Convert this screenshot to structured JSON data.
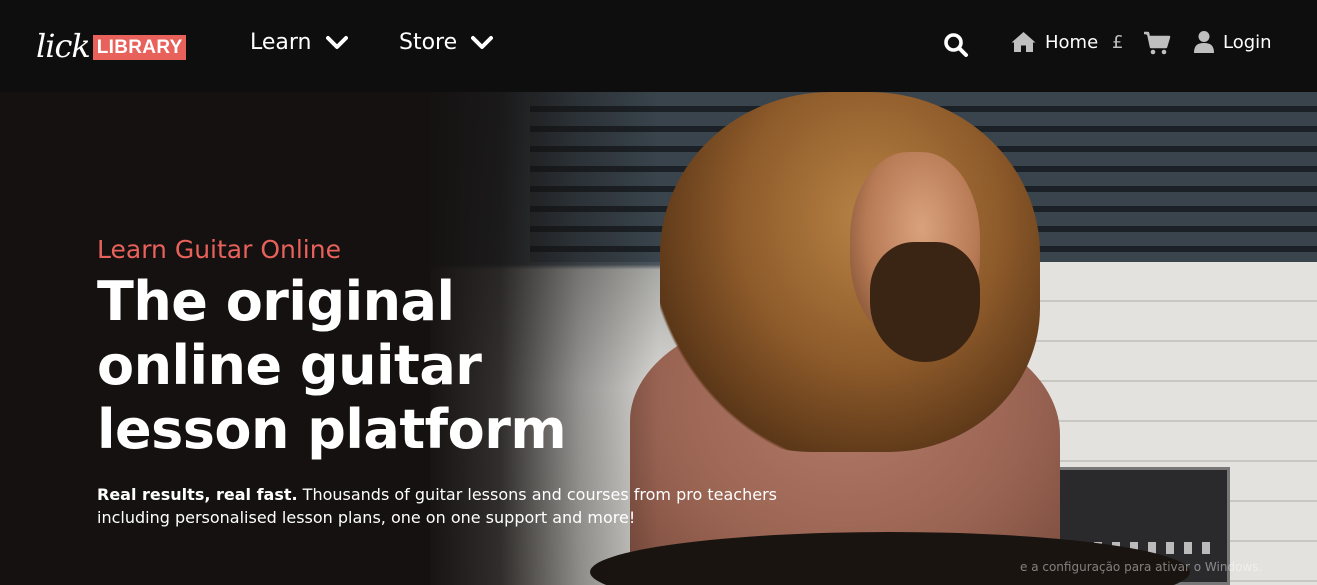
{
  "nav": {
    "logo": {
      "script": "lick",
      "badge": "LIBRARY"
    },
    "menu": [
      {
        "label": "Learn"
      },
      {
        "label": "Store"
      }
    ],
    "home_label": "Home",
    "currency": "£",
    "login_label": "Login"
  },
  "hero": {
    "eyebrow": "Learn Guitar Online",
    "headline": [
      "The original",
      "online guitar",
      "lesson platform"
    ],
    "sub_bold": "Real results, real fast.",
    "sub_rest": " Thousands of guitar lessons and courses from pro teachers",
    "sub_line2": "including personalised lesson plans, one on one support and more!"
  },
  "overlay": {
    "watermark": "e a configuração para ativar o Windows."
  },
  "colors": {
    "accent": "#e8615b",
    "nav_bg": "#0e0e0e",
    "text": "#ffffff"
  },
  "icons": [
    "chevron-down-icon",
    "search-icon",
    "home-icon",
    "cart-icon",
    "user-icon"
  ]
}
